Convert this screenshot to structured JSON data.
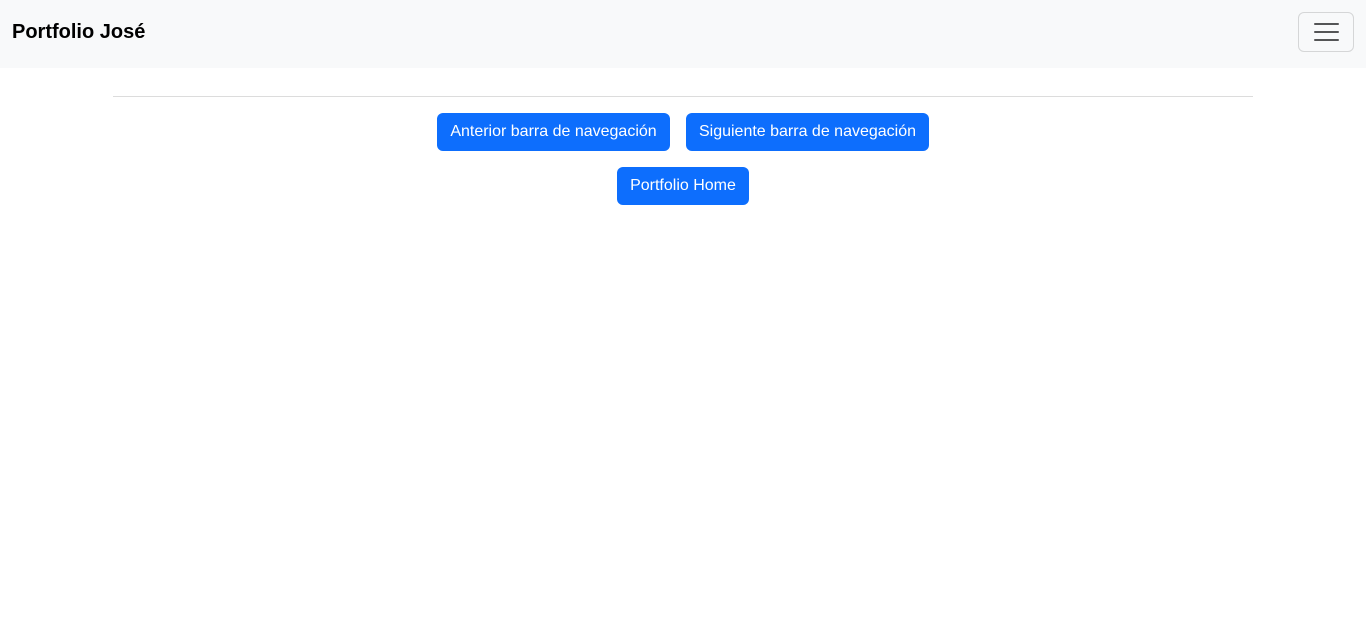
{
  "navbar": {
    "brand": "Portfolio José",
    "toggler_icon": "hamburger-menu-icon"
  },
  "nav_buttons": {
    "previous_label": "Anterior barra de navegación",
    "next_label": "Siguiente barra de navegación",
    "home_label": "Portfolio Home"
  },
  "colors": {
    "navbar_bg": "#f8f9fa",
    "primary": "#0d6efd",
    "page_bg": "#ffffff"
  }
}
